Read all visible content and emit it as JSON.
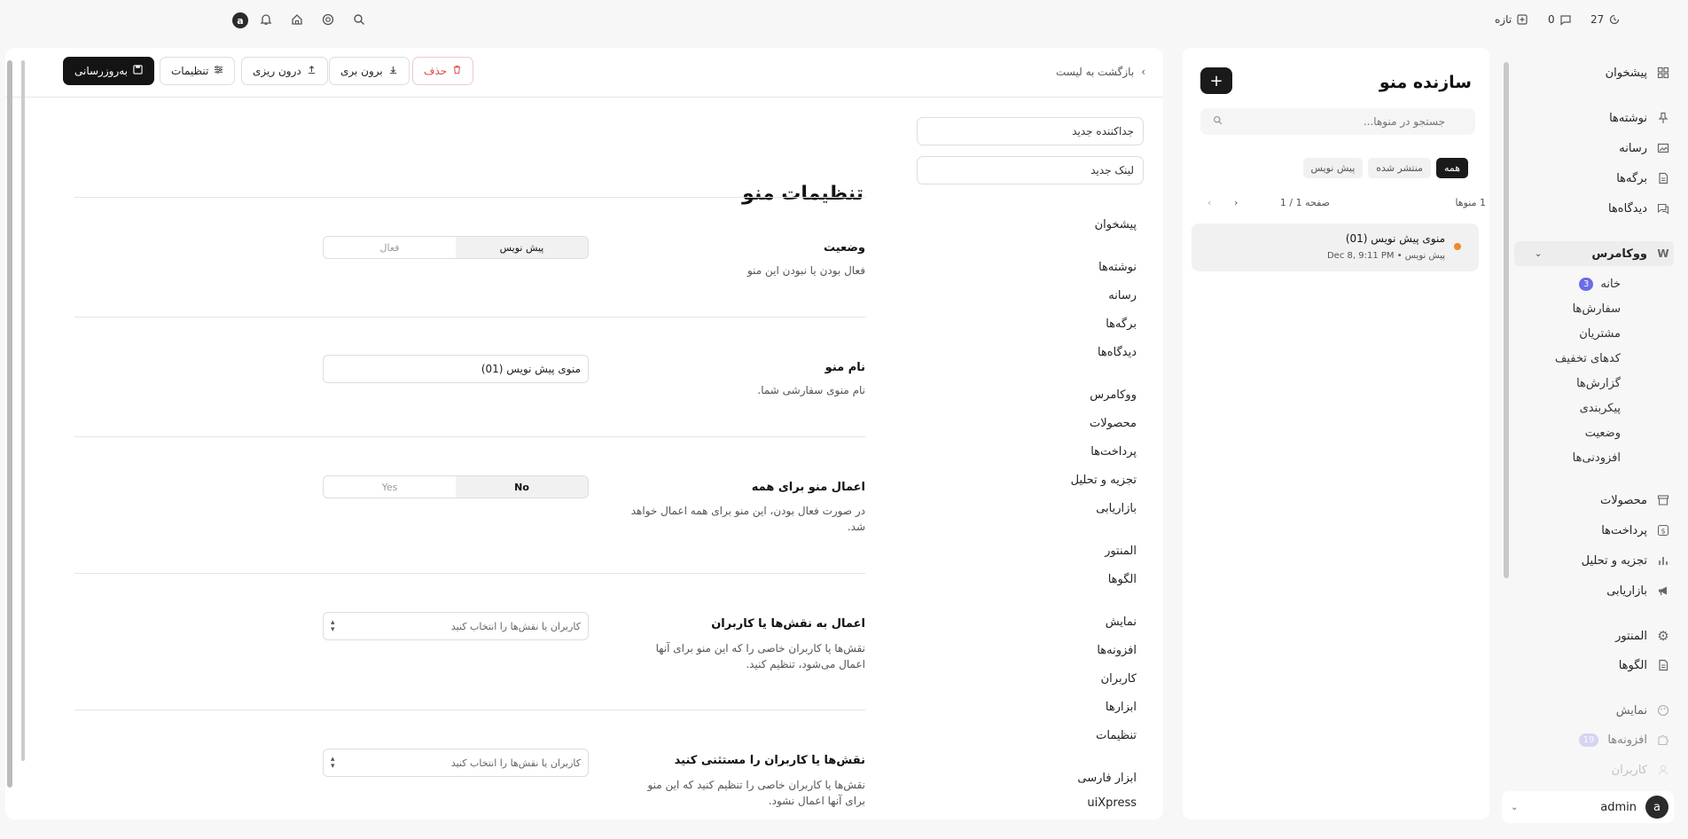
{
  "topbar": {
    "new_label": "تازه",
    "comments_count": "0",
    "updates_count": "27",
    "avatar_letter": "a"
  },
  "sidebar": {
    "dashboard": "پیشخوان",
    "posts": "نوشته‌ها",
    "media": "رسانه",
    "pages": "برگه‌ها",
    "comments": "دیدگاه‌ها",
    "woocommerce": "ووکامرس",
    "woo_home": "خانه",
    "woo_home_badge": "3",
    "woo_orders": "سفارش‌ها",
    "woo_customers": "مشتریان",
    "woo_coupons": "کدهای تخفیف",
    "woo_reports": "گزارش‌ها",
    "woo_settings": "پیکربندی",
    "woo_status": "وضعیت",
    "woo_extensions": "افزودنی‌ها",
    "products": "محصولات",
    "payments": "پرداخت‌ها",
    "analytics": "تجزیه و تحلیل",
    "marketing": "بازاریابی",
    "elementor": "المنتور",
    "templates": "الگوها",
    "appearance": "نمایش",
    "plugins": "افزونه‌ها",
    "plugins_badge": "19",
    "users": "کاربران",
    "user_name": "admin",
    "user_avatar": "a"
  },
  "builder": {
    "title": "سازنده منو",
    "add": "+",
    "search_placeholder": "جستجو در منوها...",
    "filters": [
      "همه",
      "منتشر شده",
      "پیش نویس"
    ],
    "count": "1 منوها",
    "page": "صفحه 1 / 1",
    "menu_name": "منوی پیش نویس (01)",
    "menu_meta": "پیش نویس • Dec 8, 9:11 PM"
  },
  "editor": {
    "back": "بازگشت به لیست",
    "update": "به‌روزرسانی",
    "settings": "تنظیمات",
    "import": "درون ریزی",
    "export": "برون بری",
    "delete": "حذف",
    "new_separator": "جداکننده جدید",
    "new_link": "لینک جدید",
    "nav_items": [
      "پیشخوان",
      "نوشته‌ها",
      "رسانه",
      "برگه‌ها",
      "دیدگاه‌ها",
      "ووکامرس",
      "محصولات",
      "پرداخت‌ها",
      "تجزیه و تحلیل",
      "بازاریابی",
      "المنتور",
      "الگوها",
      "نمایش",
      "افزونه‌ها",
      "کاربران",
      "ابزارها",
      "تنظیمات",
      "ابزار فارسی",
      "uiXpress"
    ],
    "settings_title": "تنظیمات منو",
    "status_label": "وضعیت",
    "status_desc": "فعال بودن یا نبودن این منو",
    "status_options": [
      "پیش نویس",
      "فعال"
    ],
    "name_label": "نام منو",
    "name_desc": "نام منوی سفارشی شما.",
    "name_value": "منوی پیش نویس (01)",
    "apply_all_label": "اعمال منو برای همه",
    "apply_all_desc": "در صورت فعال بودن، این منو برای همه اعمال خواهد شد.",
    "apply_all_options": [
      "No",
      "Yes"
    ],
    "roles_label": "اعمال به نقش‌ها یا کاربران",
    "roles_desc": "نقش‌ها یا کاربران خاصی را که این منو برای آنها اعمال می‌شود، تنظیم کنید.",
    "roles_placeholder": "کاربران یا نقش‌ها را انتخاب کنید",
    "exclude_label": "نقش‌ها یا کاربران را مستثنی کنید",
    "exclude_desc": "نقش‌ها یا کاربران خاصی را تنظیم کنید که این منو برای آنها اعمال نشود.",
    "exclude_placeholder": "کاربران یا نقش‌ها را انتخاب کنید"
  }
}
